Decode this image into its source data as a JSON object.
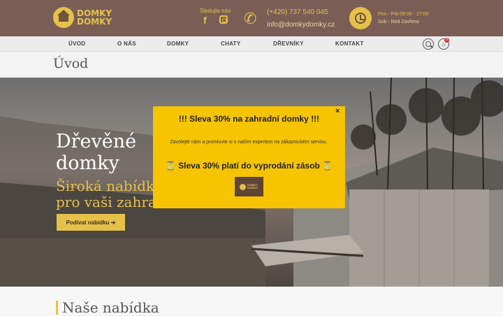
{
  "header": {
    "logo_line1": "DOMKY",
    "logo_line2": "DOMKY",
    "follow_label": "Sledujte nás",
    "facebook_glyph": "f",
    "phone": "(+420) 737 540 045",
    "email": "info@domkydomky.cz",
    "hours_weekday": "Pon - Pát 09:00 - 17:00",
    "hours_weekend": "Sob - Ned Zavřeno",
    "cart_count": "0"
  },
  "nav": {
    "items": [
      "ÚVOD",
      "O NÁS",
      "DOMKY",
      "CHATY",
      "DŘEVNÍKY",
      "KONTAKT"
    ]
  },
  "page": {
    "title": "Úvod"
  },
  "hero": {
    "heading": "Dřevěné domky",
    "subheading": "Široká nabídka pro vaši zahradu",
    "button": "Podívat nabídku ➔"
  },
  "popup": {
    "close": "×",
    "title": "!!! Sleva 30% na zahradní domky !!!",
    "text": "Zavolejte nám a promluvte si s naším expertem na zákaznickém servisu.",
    "title2": "⏳ Sleva 30% platí do vyprodání zásob ⏳",
    "logo_text": "DOMKY DOMKY"
  },
  "section": {
    "title": "Naše nabídka"
  },
  "colors": {
    "brand_brown": "#7a5e55",
    "brand_yellow": "#e5c14a",
    "popup_yellow": "#f6c400"
  }
}
